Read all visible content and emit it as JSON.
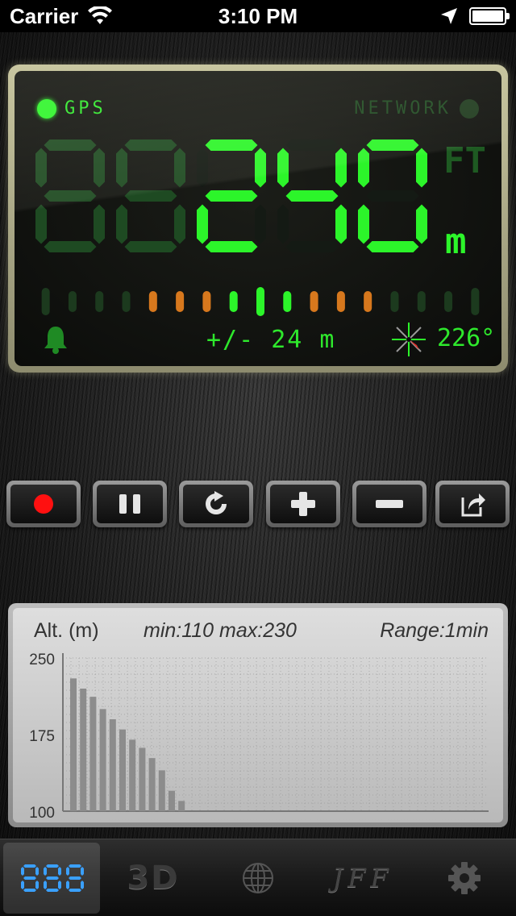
{
  "status_bar": {
    "carrier": "Carrier",
    "time": "3:10 PM",
    "icons": [
      "wifi-icon",
      "location-arrow-icon",
      "battery-icon"
    ]
  },
  "lcd": {
    "gps_label": "GPS",
    "network_label": "NETWORK",
    "gps_status": "active",
    "network_status": "inactive",
    "altitude_digits": "88240",
    "unit_ft": "FT",
    "unit_m": "m",
    "active_unit": "m",
    "accuracy": "+/- 24 m",
    "heading": "226°",
    "colors": {
      "active_green": "#2cf52a",
      "dim_green": "#1e4a22",
      "orange": "#d7781d",
      "background": "#0b0c0a"
    },
    "icons": [
      "bell-icon",
      "compass-icon"
    ]
  },
  "controls": [
    {
      "name": "record-button",
      "icon": "record-icon"
    },
    {
      "name": "pause-button",
      "icon": "pause-icon"
    },
    {
      "name": "reset-button",
      "icon": "refresh-icon"
    },
    {
      "name": "zoom-in-button",
      "icon": "plus-icon"
    },
    {
      "name": "zoom-out-button",
      "icon": "minus-icon"
    },
    {
      "name": "share-button",
      "icon": "share-icon"
    }
  ],
  "chart": {
    "ylabel": "Alt. (m)",
    "minmax": "min:110 max:230",
    "range": "Range:1min"
  },
  "chart_data": {
    "type": "bar",
    "title": "",
    "xlabel": "",
    "ylabel": "Alt. (m)",
    "ylim": [
      100,
      250
    ],
    "yticks": [
      "250",
      "175",
      "100"
    ],
    "grid": true,
    "values": [
      230,
      220,
      212,
      200,
      190,
      180,
      170,
      162,
      152,
      140,
      120,
      110
    ]
  },
  "tab_bar": {
    "tabs": [
      {
        "name": "tab-digital",
        "icon": "digital-display-icon",
        "label": "888",
        "active": true
      },
      {
        "name": "tab-3d",
        "label": "3D",
        "active": false
      },
      {
        "name": "tab-globe",
        "icon": "globe-icon",
        "active": false
      },
      {
        "name": "tab-jff",
        "label": "JFF",
        "active": false
      },
      {
        "name": "tab-settings",
        "icon": "gear-icon",
        "active": false
      }
    ]
  }
}
